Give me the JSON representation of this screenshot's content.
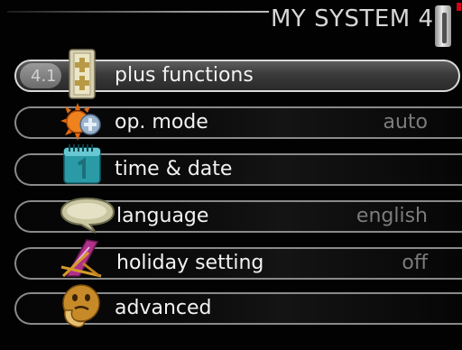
{
  "header": {
    "title": "MY SYSTEM 4"
  },
  "menu": {
    "items": [
      {
        "index": "4.1",
        "label": "plus functions",
        "value": "",
        "icon": "plus-functions-icon"
      },
      {
        "index": "",
        "label": "op. mode",
        "value": "auto",
        "icon": "sun-thermometer-icon"
      },
      {
        "index": "",
        "label": "time & date",
        "value": "",
        "icon": "calendar-icon"
      },
      {
        "index": "",
        "label": "language",
        "value": "english",
        "icon": "speech-bubble-icon"
      },
      {
        "index": "",
        "label": "holiday setting",
        "value": "off",
        "icon": "deck-chair-icon"
      },
      {
        "index": "",
        "label": "advanced",
        "value": "",
        "icon": "thinking-face-icon"
      }
    ]
  },
  "colors": {
    "selected_row": "#4a4a4a",
    "row_border": "#8a8a8a",
    "accent": "#d4001a"
  }
}
